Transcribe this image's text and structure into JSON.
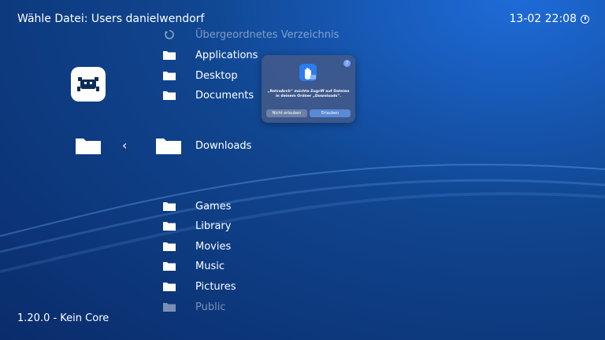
{
  "header": {
    "title": "Wähle Datei:  Users danielwendorf",
    "clock": "13-02 22:08"
  },
  "footer": {
    "version": "1.20.0 - Kein Core"
  },
  "list": {
    "items": [
      {
        "label": "Übergeordnetes Verzeichnis",
        "icon": "parent-dir-icon"
      },
      {
        "label": "Applications",
        "icon": "folder-icon"
      },
      {
        "label": "Desktop",
        "icon": "folder-icon"
      },
      {
        "label": "Documents",
        "icon": "folder-icon"
      },
      {
        "label": "Downloads",
        "icon": "folder-icon"
      },
      {
        "label": "Games",
        "icon": "folder-icon"
      },
      {
        "label": "Library",
        "icon": "folder-icon"
      },
      {
        "label": "Movies",
        "icon": "folder-icon"
      },
      {
        "label": "Music",
        "icon": "folder-icon"
      },
      {
        "label": "Pictures",
        "icon": "folder-icon"
      },
      {
        "label": "Public",
        "icon": "folder-icon"
      }
    ]
  },
  "dialog": {
    "help": "?",
    "message": "„RetroArch“ möchte Zugriff auf Dateien in deinem Ordner „Downloads“.",
    "deny_label": "Nicht erlauben",
    "allow_label": "Erlauben"
  },
  "colors": {
    "background": "#10458f",
    "dialog_bg": "#465a87",
    "allow_button": "#5a89d6"
  }
}
